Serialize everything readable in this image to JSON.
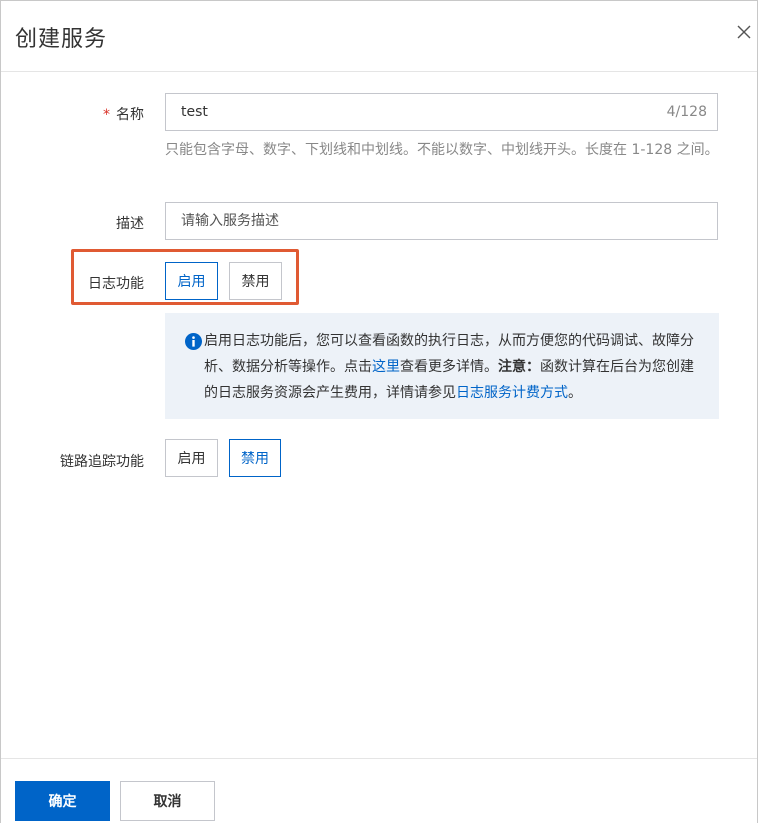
{
  "dialog": {
    "title": "创建服务",
    "close_icon": "close-icon"
  },
  "form": {
    "name": {
      "required_mark": "*",
      "label": "名称",
      "value": "test",
      "counter": "4/128",
      "hint": "只能包含字母、数字、下划线和中划线。不能以数字、中划线开头。长度在 1-128 之间。"
    },
    "description": {
      "label": "描述",
      "placeholder": "请输入服务描述"
    },
    "logging": {
      "label": "日志功能",
      "options": [
        "启用",
        "禁用"
      ],
      "selected": "启用",
      "info": {
        "icon": "info-icon",
        "text_1": "启用日志功能后，您可以查看函数的执行日志，从而方便您的代码调试、故障分析、数据分析等操作。点击",
        "link_1": "这里",
        "text_2": "查看更多详情。",
        "notice_label": "注意：",
        "text_3": "函数计算在后台为您创建的日志服务资源会产生费用，详情请参见",
        "link_2": "日志服务计费方式",
        "text_4": "。"
      }
    },
    "tracing": {
      "label": "链路追踪功能",
      "options": [
        "启用",
        "禁用"
      ],
      "selected": "禁用"
    }
  },
  "footer": {
    "confirm_label": "确定",
    "cancel_label": "取消"
  },
  "colors": {
    "accent": "#0064c8",
    "required": "#d93026",
    "highlight_border": "#e05a33",
    "info_bg": "#edf2f8"
  }
}
